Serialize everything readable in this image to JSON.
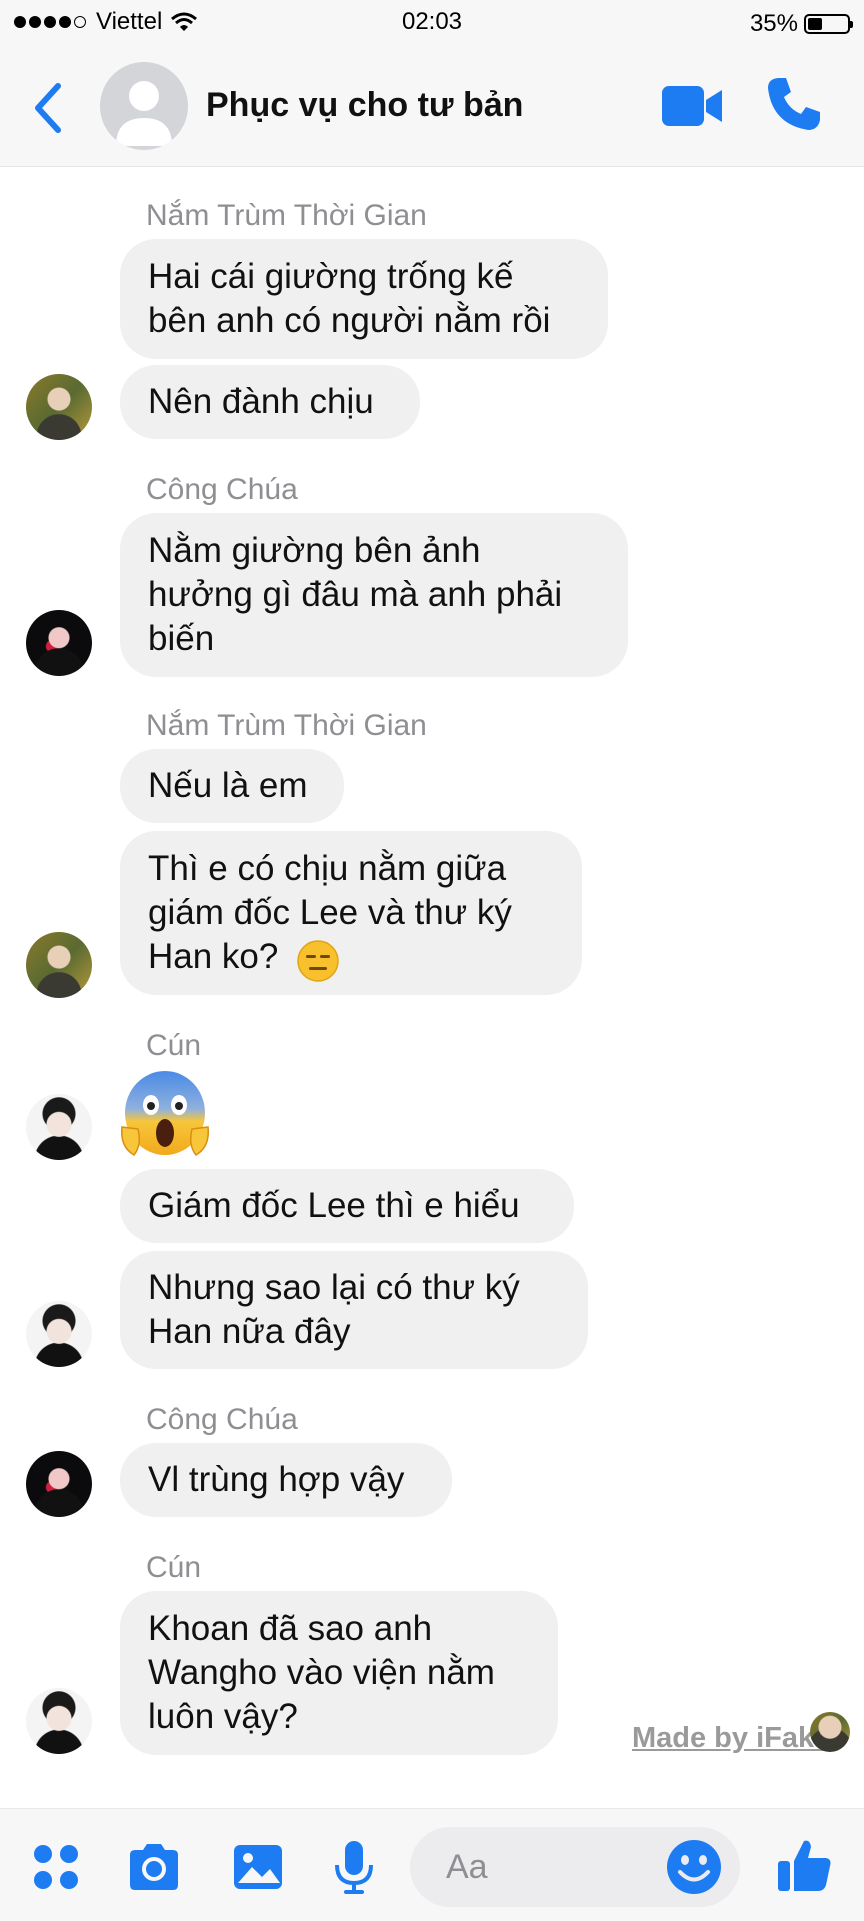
{
  "status_bar": {
    "carrier": "Viettel",
    "time": "02:03",
    "battery": "35%",
    "battery_level": 0.35
  },
  "header": {
    "title": "Phục vụ cho tư bản",
    "back_icon": "chevron-left-icon",
    "video_icon": "video-camera-icon",
    "call_icon": "phone-icon"
  },
  "messages": [
    {
      "sender": "Nắm Trùm Thời Gian"
    },
    {
      "text": "Hai cái giường trống kế\nbên anh có người nằm rồi"
    },
    {
      "text": "Nên đành chịu"
    },
    {
      "sender": "Công Chúa"
    },
    {
      "text": "Nằm giường bên ảnh\nhưởng gì đâu mà anh phải\nbiến"
    },
    {
      "sender": "Nắm Trùm Thời Gian"
    },
    {
      "text": "Nếu là em"
    },
    {
      "text": "Thì e có chịu nằm giữa\ngiám đốc Lee và thư ký\nHan ko?"
    },
    {
      "sender": "Cún"
    },
    {
      "emoji": "face-screaming-in-fear-emoji"
    },
    {
      "text": "Giám đốc Lee thì e hiểu"
    },
    {
      "text": "Nhưng sao lại có thư ký\nHan nữa đây"
    },
    {
      "sender": "Công Chúa"
    },
    {
      "text": "Vl trùng hợp vậy"
    },
    {
      "sender": "Cún"
    },
    {
      "text": "Khoan đã sao anh\nWangho vào viện nằm\nluôn vậy?"
    }
  ],
  "watermark": "Made by iFake",
  "composer": {
    "placeholder": "Aa",
    "icons": [
      "apps-icon",
      "camera-icon",
      "gallery-icon",
      "microphone-icon",
      "emoji-icon",
      "thumbs-up-icon"
    ]
  },
  "colors": {
    "accent": "#1d7cf2",
    "bubble": "#f0f0f0",
    "sender": "#8e8e93"
  }
}
